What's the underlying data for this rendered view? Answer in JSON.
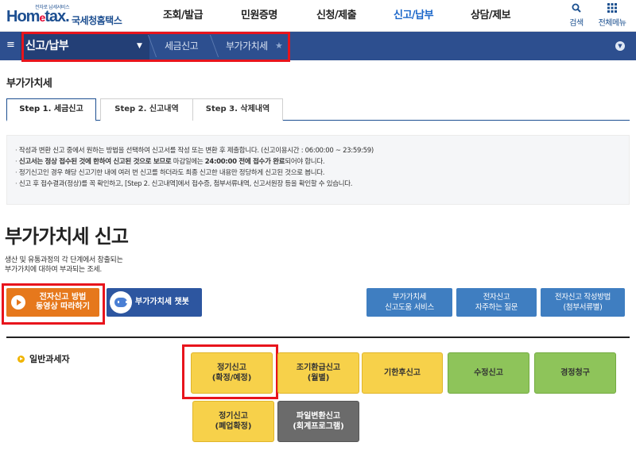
{
  "header": {
    "logo_tag": "전자로 납세서비스",
    "logo_main_a": "Hom",
    "logo_main_e": "e",
    "logo_main_b": "tax.",
    "logo_kor": "국세청홈택스",
    "nav": [
      "조회/발급",
      "민원증명",
      "신청/제출",
      "신고/납부",
      "상담/제보"
    ],
    "active_nav_index": 3,
    "tools": {
      "search": "검색",
      "all_menu": "전체메뉴"
    }
  },
  "breadcrumb": {
    "menu_icon": "hamburger-icon",
    "main": "신고/납부",
    "items": [
      "세금신고",
      "부가가치세"
    ]
  },
  "page": {
    "title": "부가가치세",
    "tabs": [
      "Step 1. 세금신고",
      "Step 2. 신고내역",
      "Step 3. 삭제내역"
    ],
    "active_tab": 0
  },
  "notice": {
    "line1": "작성과 변환 신고 중에서 원하는 방법을 선택하여 신고서를 작성 또는 변환 후 제출합니다. (신고이용시간 : 06:00:00 ~ 23:59:59)",
    "line2_bold_a": "신고서는 정상 접수된 것에 한하여 신고된 것으로 보므로",
    "line2_plain_a": " 마감일에는 ",
    "line2_bold_b": "24:00:00 전에 접수가 완료",
    "line2_plain_b": "되어야 합니다.",
    "line3": "정기신고인 경우 해당 신고기한 내에 여러 번 신고를 하더라도 최종 신고한 내용만 정당하게 신고된 것으로 봅니다.",
    "line4": "신고 후 접수결과(정상)를 꼭 확인하고, [Step 2. 신고내역]에서 접수증, 첨부서류내역, 신고서원장 등을 확인할 수 있습니다."
  },
  "intro": {
    "title": "부가가치세 신고",
    "desc_line1": "생산 및 유통과정의 각 단계에서 창출되는",
    "desc_line2": "부가가치에 대하여 부과되는 조세."
  },
  "actions": {
    "video_line1": "전자신고 방법",
    "video_line2": "동영상 따라하기",
    "chatbot": "부가가치세 챗봇",
    "svc1_line1": "부가가치세",
    "svc1_line2": "신고도움 서비스",
    "svc2_line1": "전자신고",
    "svc2_line2": "자주하는 질문",
    "svc3_line1": "전자신고 작성방법",
    "svc3_line2": "(첨부서류별)"
  },
  "section": {
    "label": "일반과세자",
    "buttons": [
      {
        "line1": "정기신고",
        "line2": "(확정/예정)"
      },
      {
        "line1": "조기환급신고",
        "line2": "(월별)"
      },
      {
        "line1": "기한후신고",
        "line2": ""
      },
      {
        "line1": "수정신고",
        "line2": ""
      },
      {
        "line1": "경정청구",
        "line2": ""
      },
      {
        "line1": "정기신고",
        "line2": "(폐업확정)"
      },
      {
        "line1": "파일변환신고",
        "line2": "(회계프로그램)"
      }
    ]
  },
  "colors": {
    "brand_blue": "#1d4f91",
    "crumb_bar": "#2d4f8f",
    "highlight_red": "#e8141c",
    "video_orange": "#e6781c",
    "service_blue": "#3f7ec1",
    "yellow_button": "#f7d14a",
    "green_button": "#8ec45a",
    "gray_button": "#6b6b6b"
  }
}
